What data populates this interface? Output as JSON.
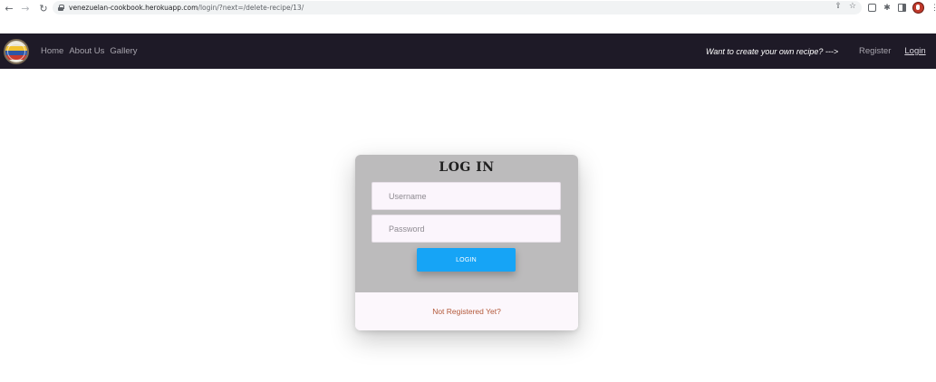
{
  "browser": {
    "url_host": "venezuelan-cookbook.herokuapp.com",
    "url_path": "/login/?next=/delete-recipe/13/"
  },
  "navbar": {
    "links": [
      "Home",
      "About Us",
      "Gallery"
    ],
    "tagline": "Want to create your own recipe? --->",
    "register": "Register",
    "login": "Login"
  },
  "login_card": {
    "title": "LOG IN",
    "username_placeholder": "Username",
    "password_placeholder": "Password",
    "button_label": "LOGIN",
    "register_prompt": "Not Registered Yet?"
  },
  "colors": {
    "navbar_bg": "#1e1a27",
    "button_bg": "#16a4f6",
    "card_bg": "#bcbbbc",
    "register_link": "#b3593a"
  },
  "icons": {
    "back": "arrow-left-icon",
    "forward": "arrow-right-icon",
    "reload": "reload-icon",
    "lock": "lock-icon",
    "share": "share-icon",
    "star": "star-icon",
    "extension": "puzzle-icon",
    "panel": "side-panel-icon",
    "menu": "kebab-menu-icon"
  }
}
